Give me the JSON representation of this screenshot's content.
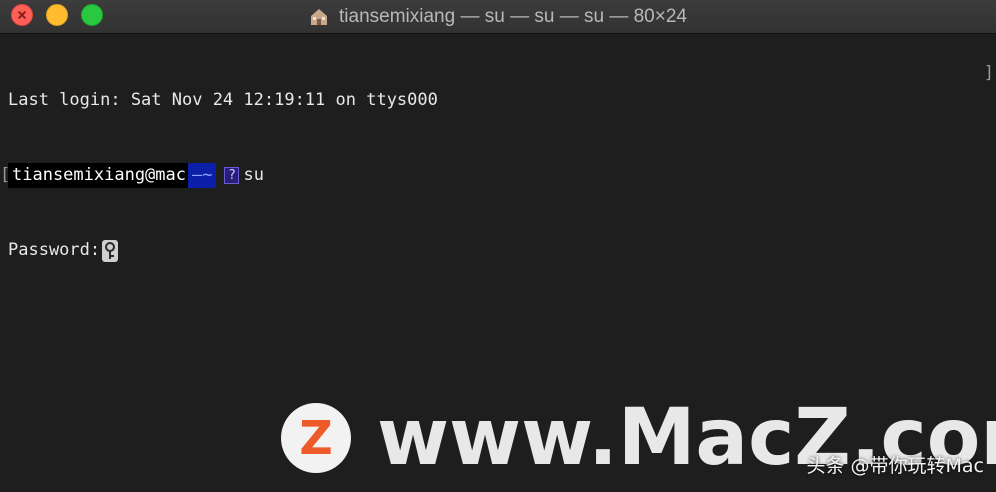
{
  "window": {
    "title": "tiansemixiang — su — su — su — 80×24",
    "title_icon": "home-folder-icon",
    "traffic_lights": {
      "close_color": "#fe5f57",
      "minimize_color": "#febc2e",
      "maximize_color": "#28c840"
    }
  },
  "terminal": {
    "background": "#1e1e1e",
    "lines": {
      "last_login": "Last login: Sat Nov 24 12:19:11 on ttys000",
      "bracket_left": "[",
      "prompt_user": "tiansemixiang@mac",
      "prompt_dir": "―~",
      "prompt_symbol": "?",
      "command": "su",
      "password_label": "Password:",
      "bracket_right": "]"
    }
  },
  "watermark": {
    "logo_letter": "Z",
    "text": "www.MacZ.com",
    "sub": "头条 @带你玩转Mac",
    "logo_color": "#ef5a2a"
  }
}
